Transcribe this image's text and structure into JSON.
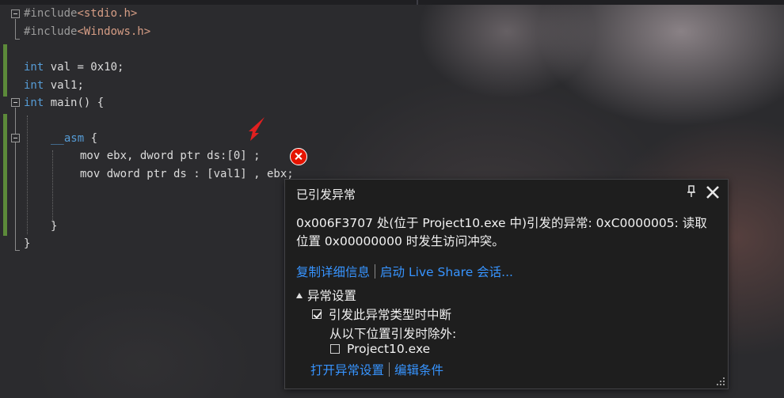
{
  "editor": {
    "lines": {
      "l1_pp": "#include",
      "l1_inc": "<stdio.h>",
      "l2_pp": "#include",
      "l2_inc": "<Windows.h>",
      "l4_kw": "int",
      "l4_rest": " val = 0x10;",
      "l5_kw": "int",
      "l5_rest": " val1;",
      "l6_kw": "int",
      "l6_rest": " main() {",
      "l8_kw": "__asm",
      "l8_rest": " {",
      "l9": "mov ebx, dword ptr ds:[0] ;",
      "l10": "mov dword ptr ds : [val1] , ebx;",
      "l13": "}",
      "l14": "}"
    },
    "error_marker_icon": "error-circle-x-icon",
    "annotation_icon": "red-arrow-icon"
  },
  "exception_popup": {
    "title": "已引发异常",
    "pin_icon": "pin-icon",
    "close_icon": "close-icon",
    "message": "0x006F3707 处(位于 Project10.exe 中)引发的异常: 0xC0000005: 读取位置 0x00000000 时发生访问冲突。",
    "copy_details_link": "复制详细信息",
    "live_share_link": "启动 Live Share 会话...",
    "settings_heading": "异常设置",
    "break_checkbox_label": "引发此异常类型时中断",
    "break_checked": true,
    "except_label": "从以下位置引发时除外:",
    "module_checkbox_label": "Project10.exe",
    "module_checked": false,
    "open_settings_link": "打开异常设置",
    "edit_conditions_link": "编辑条件"
  },
  "colors": {
    "keyword": "#569cd6",
    "include_path": "#d69d85",
    "link": "#3794ff",
    "error": "#e51400"
  }
}
